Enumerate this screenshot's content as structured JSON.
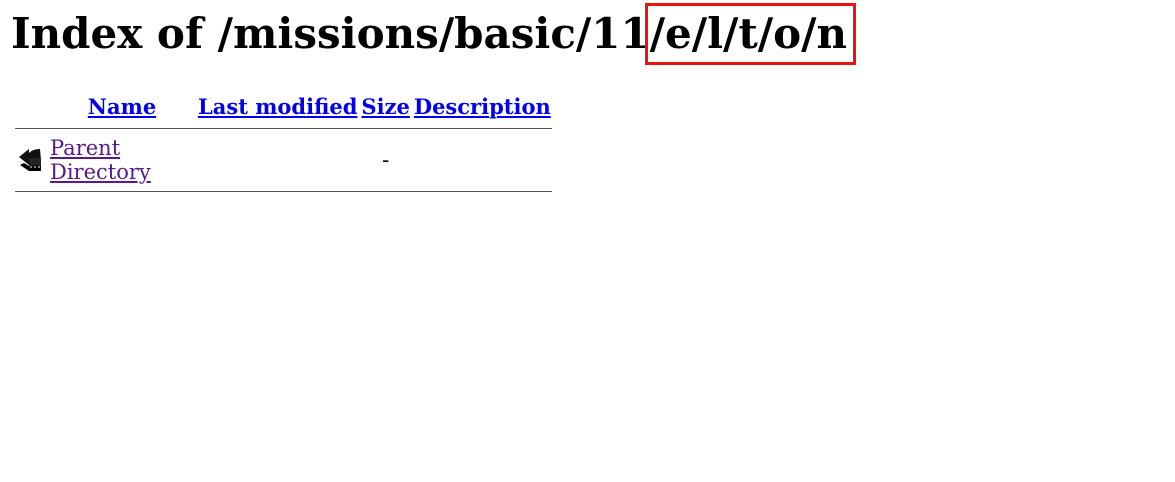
{
  "page": {
    "title_prefix": "Index of /missions/basic/11",
    "title_highlight": "/e/l/t/o/n",
    "highlight_color": "#ee1111"
  },
  "table": {
    "headers": {
      "name": "Name",
      "last_modified": "Last modified",
      "size": "Size",
      "description": "Description"
    },
    "rows": [
      {
        "icon": "back-arrow-icon",
        "name": "Parent Directory",
        "last_modified": "",
        "size": "-",
        "description": ""
      }
    ]
  },
  "colors": {
    "link": "#0000ee",
    "visited_link": "#551a8b",
    "rule": "#555555"
  }
}
